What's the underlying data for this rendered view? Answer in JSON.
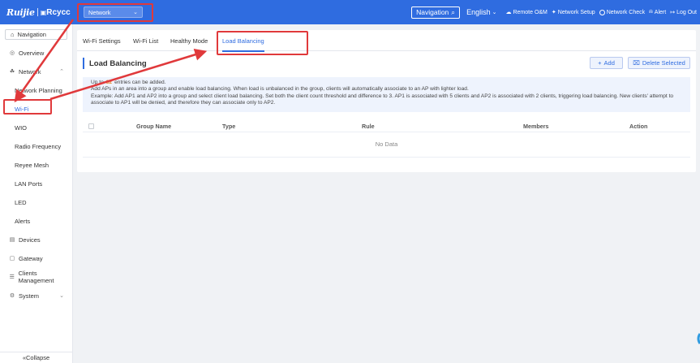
{
  "topbar": {
    "brand_primary": "Ruijie",
    "brand_secondary": "Rcycc",
    "network_select": "Network",
    "navigation_label": "Navigation",
    "language": "English",
    "links": [
      "Remote O&M",
      "Network Setup",
      "Network Check",
      "Alert",
      "Log Out"
    ]
  },
  "sidebar": {
    "nav_button": "Navigation",
    "items": [
      {
        "label": "Overview",
        "icon": "overview-icon"
      },
      {
        "label": "Network",
        "icon": "network-icon"
      },
      {
        "label": "Network Planning"
      },
      {
        "label": "Wi-Fi"
      },
      {
        "label": "WIO"
      },
      {
        "label": "Radio Frequency"
      },
      {
        "label": "Reyee Mesh"
      },
      {
        "label": "LAN Ports"
      },
      {
        "label": "LED"
      },
      {
        "label": "Alerts"
      },
      {
        "label": "Devices",
        "icon": "devices-icon"
      },
      {
        "label": "Gateway",
        "icon": "gateway-icon"
      },
      {
        "label": "Clients Management",
        "icon": "clients-icon"
      },
      {
        "label": "System",
        "icon": "system-icon"
      }
    ],
    "collapse": "Collapse"
  },
  "tabs": [
    "Wi-Fi Settings",
    "Wi-Fi List",
    "Healthy Mode",
    "Load Balancing"
  ],
  "section": {
    "title": "Load Balancing",
    "add": "Add",
    "delete": "Delete Selected"
  },
  "info": {
    "prefix": "Up to",
    "max_entries": "32",
    "suffix": "entries can be added.",
    "line2": "Add APs in an area into a group and enable load balancing. When load is unbalanced in the group, clients will automatically associate to an AP with lighter load.",
    "line3": "Example: Add AP1 and AP2 into a group and select client load balancing. Set both the client count threshold and difference to 3. AP1 is associated with 5 clients and AP2 is associated with 2 clients, triggering load balancing. New clients'    attempt to",
    "line4": "associate to AP1 will be denied, and therefore they can associate only to AP2."
  },
  "table": {
    "columns": [
      "Group Name",
      "Type",
      "Rule",
      "Members",
      "Action"
    ],
    "empty": "No Data"
  },
  "colors": {
    "primary": "#2f6ce0",
    "annotation": "#e0393b",
    "accent_number": "#e6862a"
  }
}
